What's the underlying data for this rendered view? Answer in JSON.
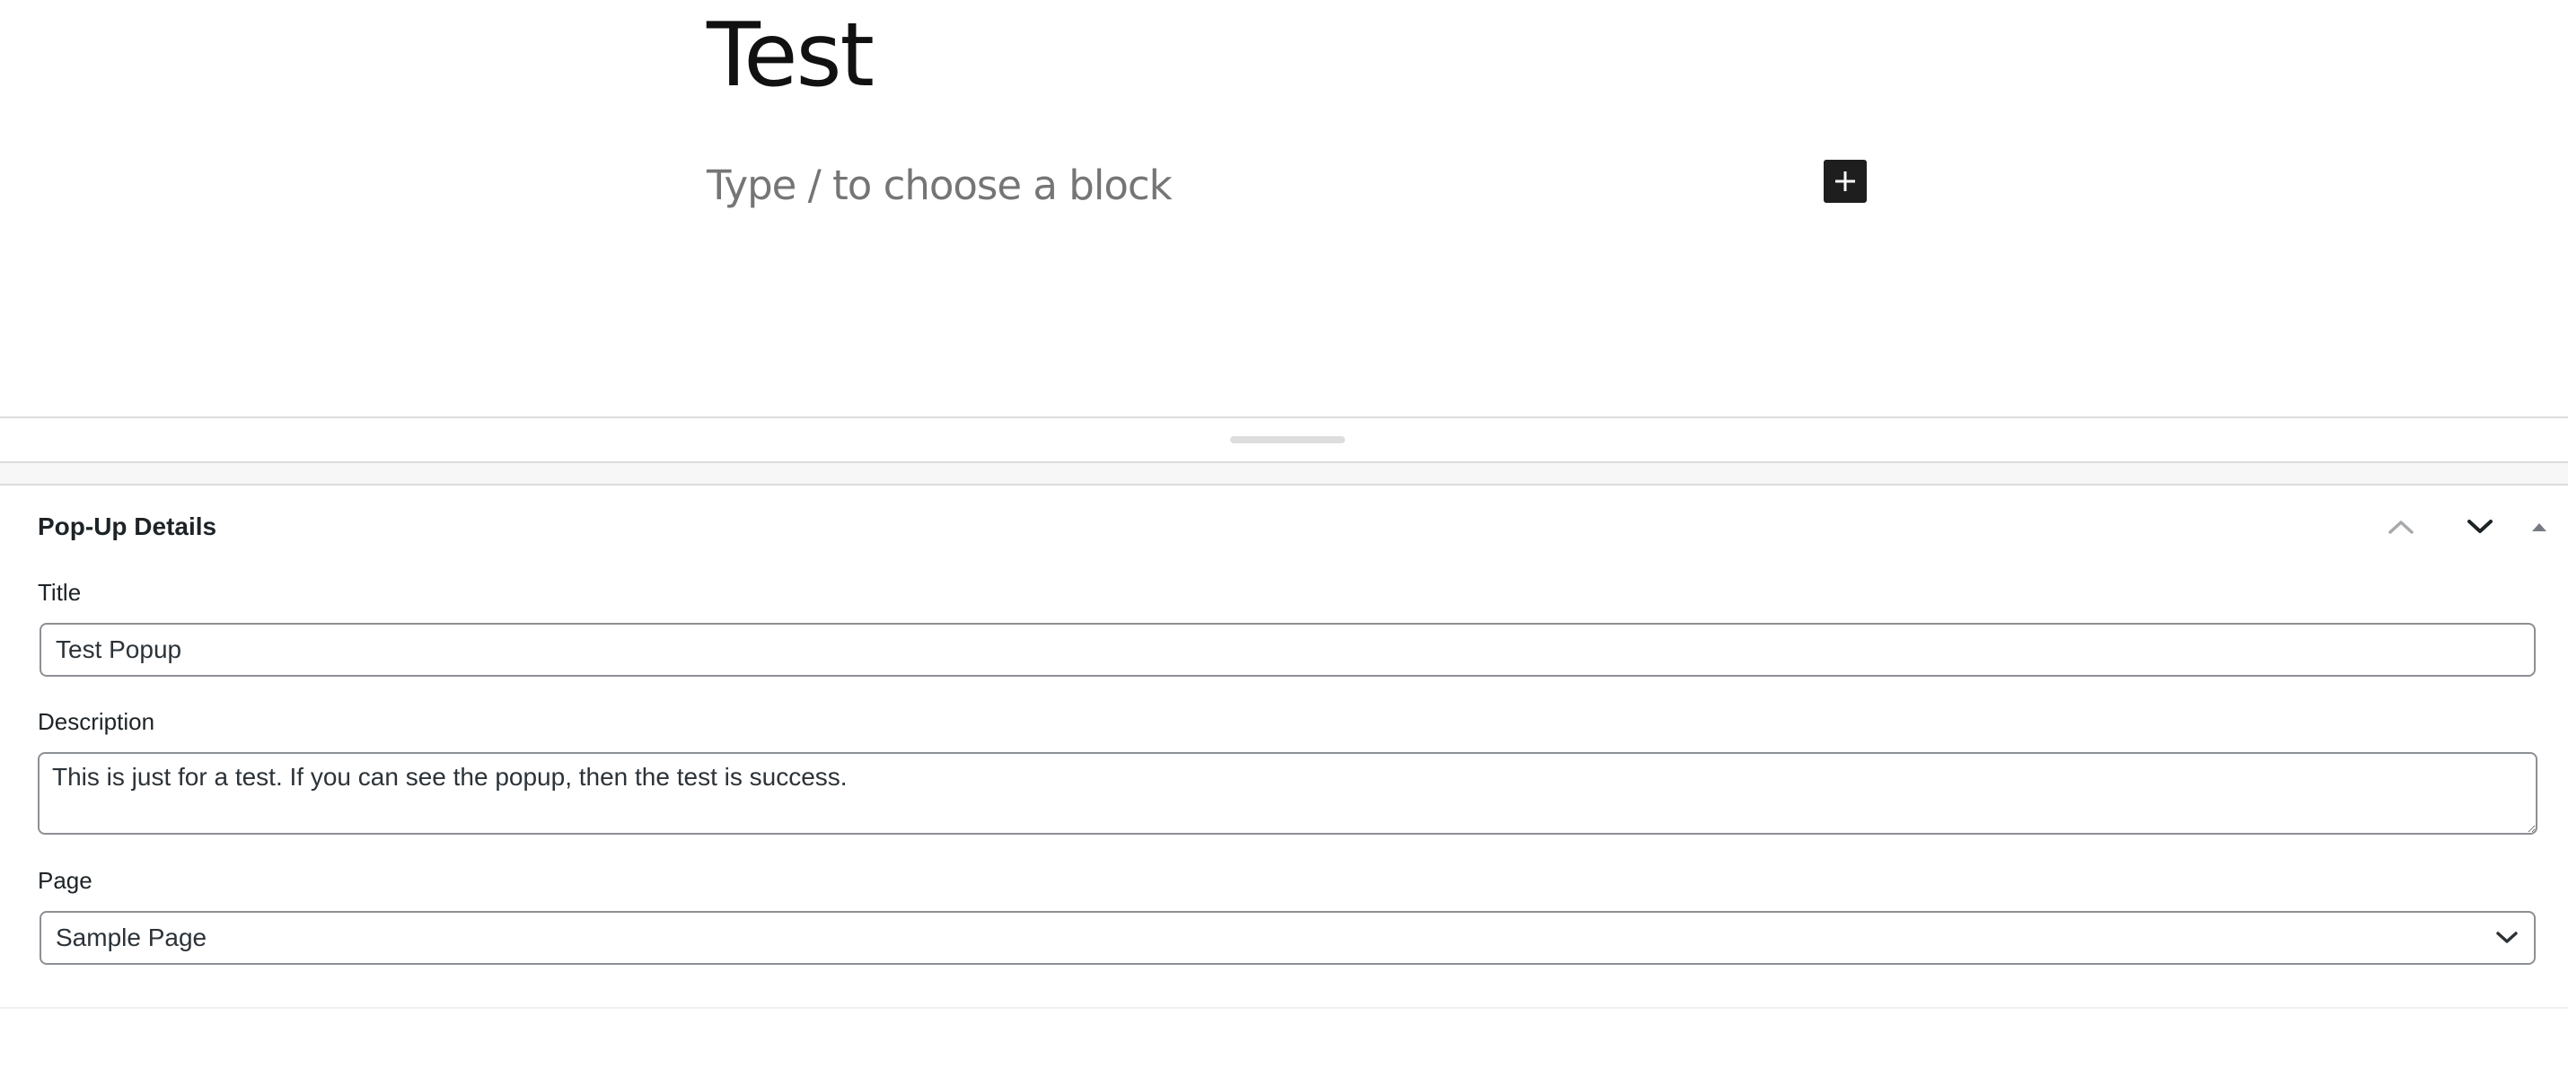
{
  "editor": {
    "post_title": "Test",
    "block_placeholder": "Type / to choose a block",
    "inserter_icon": "plus-icon"
  },
  "metabox": {
    "title": "Pop-Up Details",
    "controls": {
      "move_up_icon": "chevron-up-icon",
      "move_down_icon": "chevron-down-icon",
      "toggle_icon": "caret-up-icon"
    },
    "fields": {
      "title": {
        "label": "Title",
        "value": "Test Popup"
      },
      "description": {
        "label": "Description",
        "value": "This is just for a test. If you can see the popup, then the test is success."
      },
      "page": {
        "label": "Page",
        "selected": "Sample Page",
        "icon": "chevron-down-icon"
      }
    }
  },
  "colors": {
    "text_dark": "#1e1e1e",
    "placeholder": "#757575",
    "border": "#8c8f94",
    "divider": "#dcdcde",
    "inserter_bg": "#1e1e1e"
  }
}
